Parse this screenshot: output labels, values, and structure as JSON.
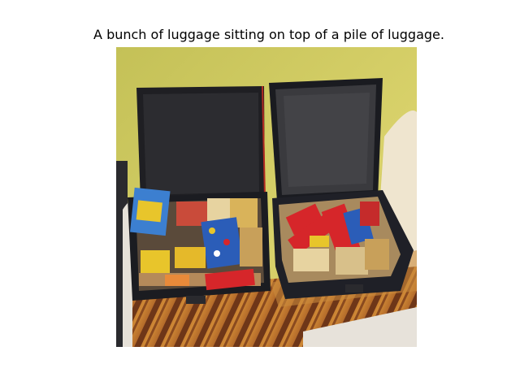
{
  "figure": {
    "caption": "A bunch of luggage sitting on top of a pile of luggage."
  },
  "photo": {
    "subject_icon": "luggage-photo",
    "palette": {
      "wall": "#cfc85e",
      "suitcase": "#1c1d22",
      "lid_lining": "#2b2b2e",
      "blanket": "#c7782a",
      "sheet": "#e9e4da",
      "candy_red": "#d6262a",
      "candy_blue": "#2b5db8",
      "candy_yellow": "#e8c52b"
    }
  }
}
